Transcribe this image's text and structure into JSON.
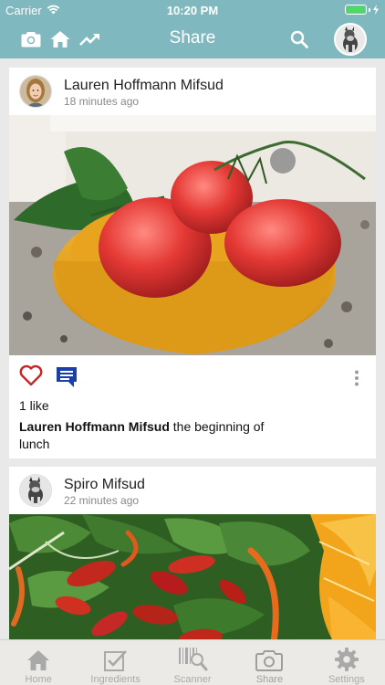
{
  "status_bar": {
    "carrier": "Carrier",
    "time": "10:20 PM",
    "battery_level": 1.0
  },
  "nav": {
    "title": "Share",
    "left_icons": [
      "camera-icon",
      "home-icon",
      "trending-up-icon"
    ],
    "right_icons": [
      "search-icon"
    ]
  },
  "posts": [
    {
      "author": "Lauren Hoffmann Mifsud",
      "time": "18 minutes ago",
      "likes": "1 like",
      "caption_author": "Lauren Hoffmann Mifsud",
      "caption_text": " the beginning of lunch",
      "liked": false
    },
    {
      "author": "Spiro Mifsud",
      "time": "22 minutes ago"
    }
  ],
  "tabs": [
    {
      "label": "Home",
      "icon": "home-icon"
    },
    {
      "label": "Ingredients",
      "icon": "checklist-icon"
    },
    {
      "label": "Scanner",
      "icon": "barcode-scanner-icon"
    },
    {
      "label": "Share",
      "icon": "camera-icon",
      "active": true
    },
    {
      "label": "Settings",
      "icon": "gear-icon"
    }
  ],
  "colors": {
    "accent": "#7fb9bf",
    "heart": "#c62828",
    "comment": "#1a3fa8",
    "battery": "#4cd964"
  }
}
